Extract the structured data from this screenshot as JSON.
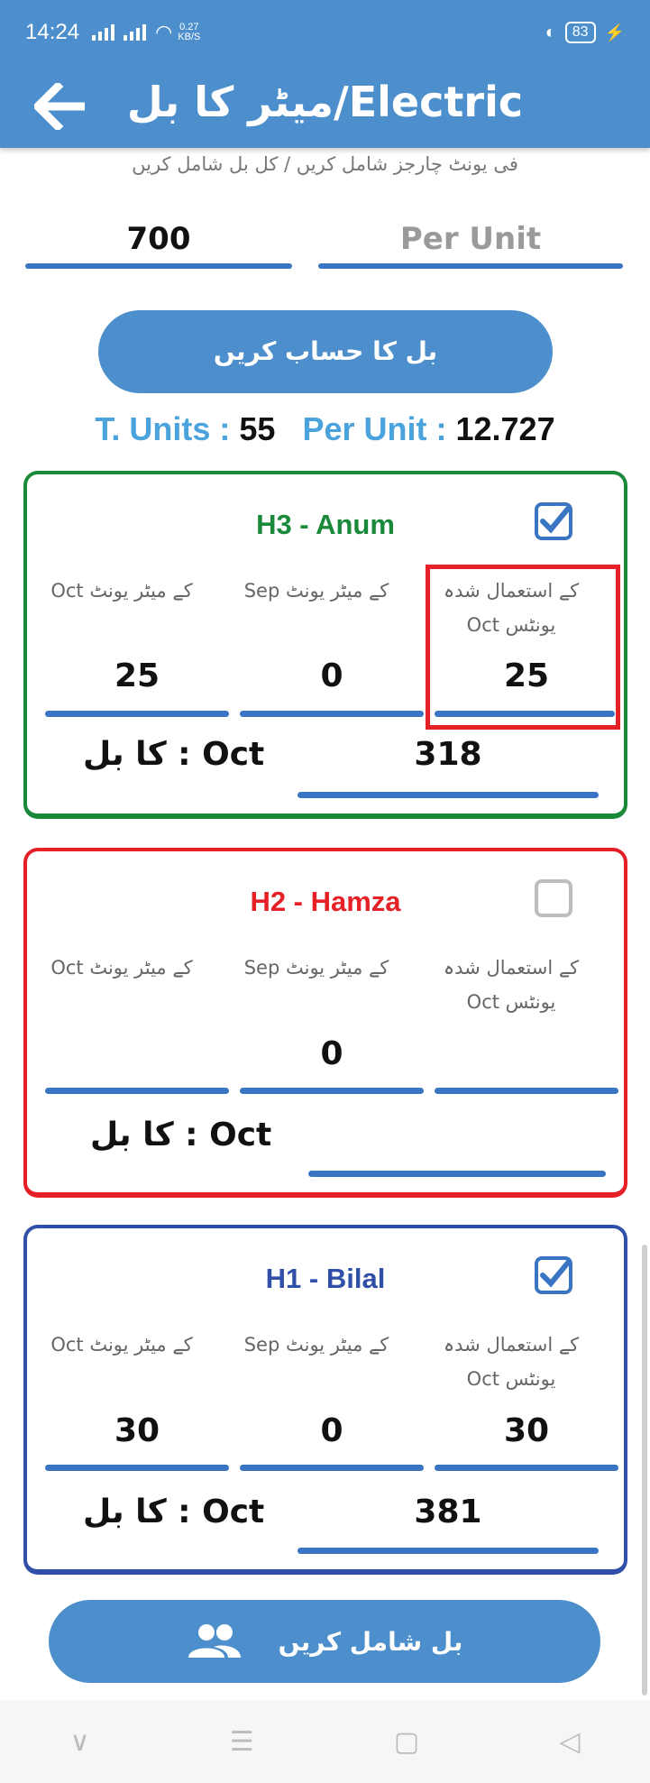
{
  "status": {
    "time": "14:24",
    "speed": "0.27",
    "speed_unit": "KB/S",
    "battery": "83"
  },
  "appbar": {
    "title": "میٹر کا بل/Electric"
  },
  "hint": "فی یونٹ چارجز شامل کریں / کل بل شامل کریں",
  "inputs": {
    "total_bill": "700",
    "per_unit_placeholder": "Per Unit"
  },
  "calc_button": "بل کا حساب کریں",
  "totals": {
    "units_label": "T. Units : ",
    "units_value": "55",
    "per_unit_label": "Per Unit : ",
    "per_unit_value": "12.727"
  },
  "labels": {
    "used_units": "کے استعمال شدہ یونٹس Oct",
    "prev_meter": "کے میٹر یونٹ Sep",
    "curr_meter": "کے میٹر یونٹ Oct",
    "bill": "کا بل : Oct"
  },
  "cards": [
    {
      "name": "H3 - Anum",
      "color": "#1a8a3a",
      "checked": true,
      "curr": "25",
      "prev": "0",
      "used": "25",
      "bill": "318"
    },
    {
      "name": "H2 - Hamza",
      "color": "#e52027",
      "checked": false,
      "curr": "",
      "prev": "0",
      "used": "",
      "bill": ""
    },
    {
      "name": "H1 - Bilal",
      "color": "#2f4fa8",
      "checked": true,
      "curr": "30",
      "prev": "0",
      "used": "30",
      "bill": "381"
    }
  ],
  "add_button": "بل شامل کریں"
}
